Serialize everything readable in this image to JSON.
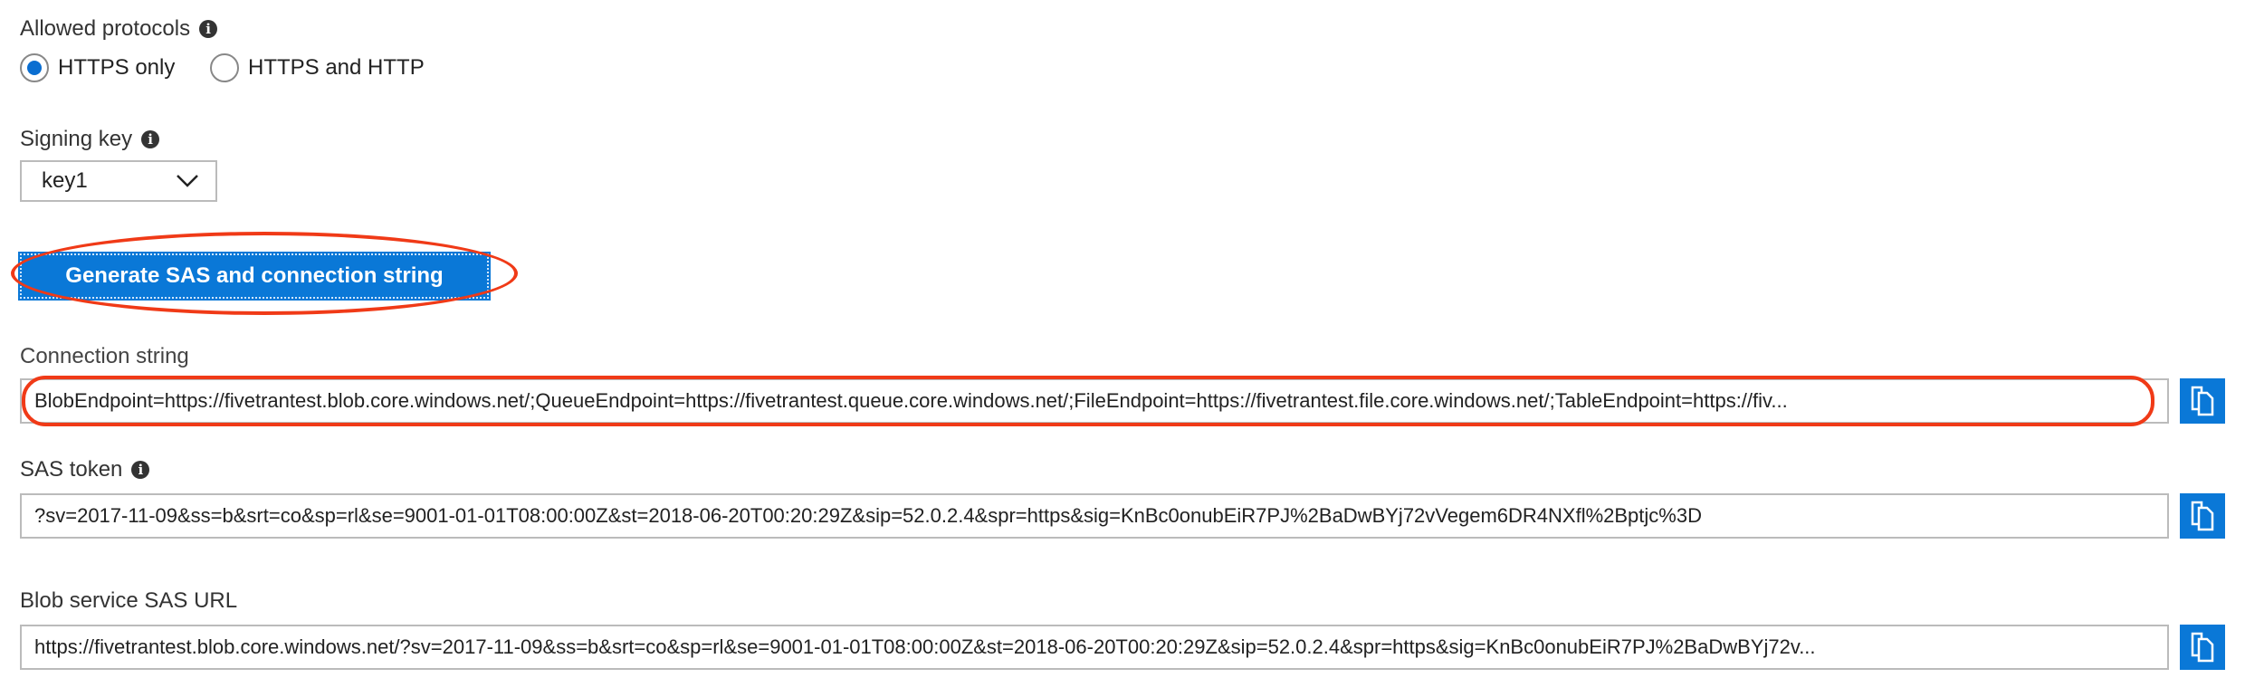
{
  "protocols": {
    "label": "Allowed protocols",
    "options": [
      {
        "label": "HTTPS only",
        "selected": true
      },
      {
        "label": "HTTPS and HTTP",
        "selected": false
      }
    ]
  },
  "signing_key": {
    "label": "Signing key",
    "value": "key1"
  },
  "generate_button": {
    "label": "Generate SAS and connection string"
  },
  "connection_string": {
    "label": "Connection string",
    "value": "BlobEndpoint=https://fivetrantest.blob.core.windows.net/;QueueEndpoint=https://fivetrantest.queue.core.windows.net/;FileEndpoint=https://fivetrantest.file.core.windows.net/;TableEndpoint=https://fiv..."
  },
  "sas_token": {
    "label": "SAS token",
    "value": "?sv=2017-11-09&ss=b&srt=co&sp=rl&se=9001-01-01T08:00:00Z&st=2018-06-20T00:20:29Z&sip=52.0.2.4&spr=https&sig=KnBc0onubEiR7PJ%2BaDwBYj72vVegem6DR4NXfl%2Bptjc%3D"
  },
  "blob_sas_url": {
    "label": "Blob service SAS URL",
    "value": "https://fivetrantest.blob.core.windows.net/?sv=2017-11-09&ss=b&srt=co&sp=rl&se=9001-01-01T08:00:00Z&st=2018-06-20T00:20:29Z&sip=52.0.2.4&spr=https&sig=KnBc0onubEiR7PJ%2BaDwBYj72v..."
  },
  "colors": {
    "accent": "#0a78d7",
    "annotation": "#f03a17"
  },
  "icons": {
    "info": "info-icon",
    "copy": "copy-icon",
    "chevron": "chevron-down-icon"
  }
}
